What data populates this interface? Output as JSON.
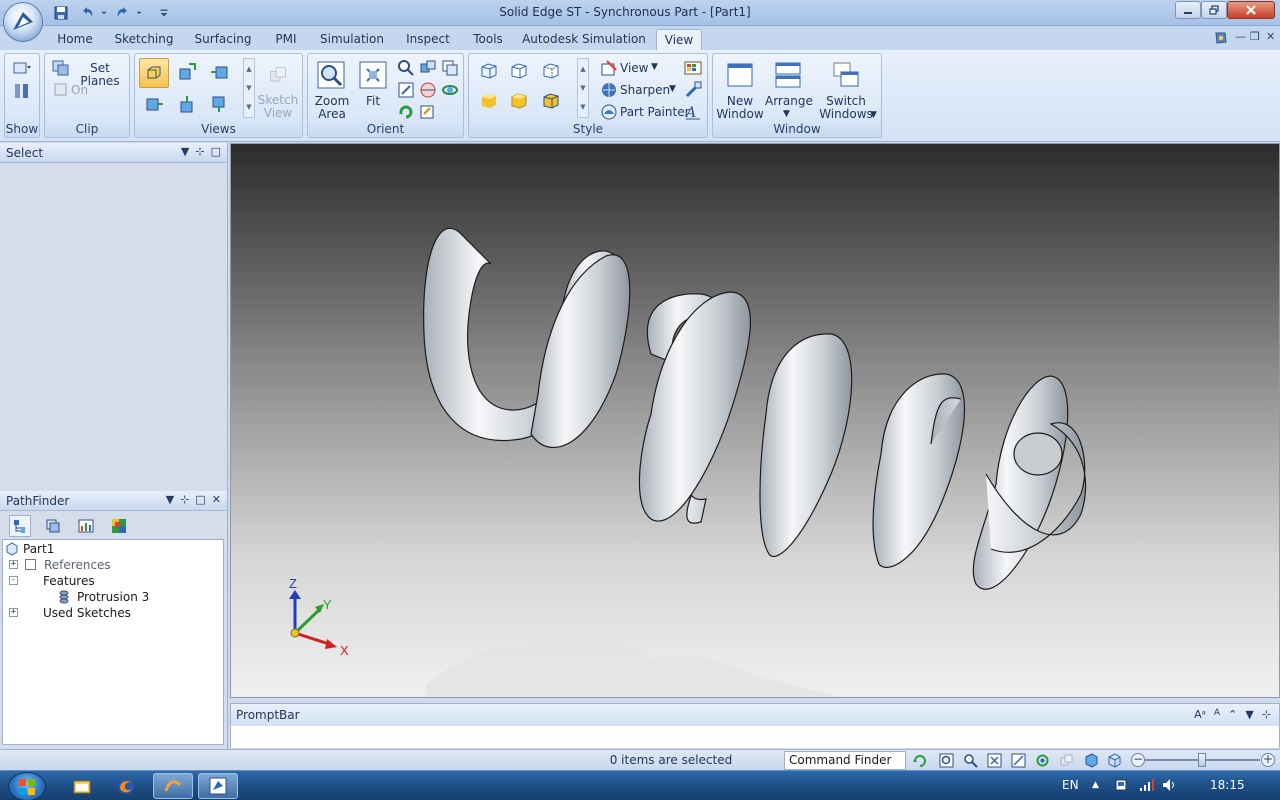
{
  "window": {
    "title": "Solid Edge ST - Synchronous Part - [Part1]",
    "controls": [
      "minimize-icon",
      "restore-icon",
      "close-icon"
    ]
  },
  "quick_access": [
    "save-icon",
    "undo-icon",
    "redo-icon",
    "customize-icon"
  ],
  "tabs": [
    {
      "label": "Home"
    },
    {
      "label": "Sketching"
    },
    {
      "label": "Surfacing"
    },
    {
      "label": "PMI"
    },
    {
      "label": "Simulation"
    },
    {
      "label": "Inspect"
    },
    {
      "label": "Tools"
    },
    {
      "label": "Autodesk Simulation"
    },
    {
      "label": "View",
      "active": true
    }
  ],
  "ribbon": {
    "groups": {
      "show": "Show",
      "clip": "Clip",
      "views": "Views",
      "orient": "Orient",
      "style": "Style",
      "window": "Window"
    },
    "clip": {
      "set_planes": "Set Planes",
      "on": "On"
    },
    "views": {
      "sketch_view": "Sketch\nView"
    },
    "orient": {
      "zoom_area": "Zoom\nArea",
      "fit": "Fit"
    },
    "style": {
      "view": "View",
      "sharpen": "Sharpen",
      "part_painter": "Part Painter"
    },
    "window": {
      "new_window": "New\nWindow",
      "arrange": "Arrange",
      "switch_windows": "Switch\nWindows"
    }
  },
  "select_panel": {
    "title": "Select"
  },
  "pathfinder": {
    "title": "PathFinder",
    "tree": [
      {
        "label": "Part1",
        "level": 0,
        "icon": "part-icon"
      },
      {
        "label": "References",
        "level": 1,
        "expander": "+",
        "checkbox": true
      },
      {
        "label": "Features",
        "level": 1,
        "expander": "-"
      },
      {
        "label": "Protrusion 3",
        "level": 2,
        "icon": "protrusion-icon"
      },
      {
        "label": "Used Sketches",
        "level": 1,
        "expander": "+"
      }
    ]
  },
  "viewport": {
    "model": "helical-spring",
    "triad": {
      "z": "Z",
      "y": "Y",
      "x": "X"
    }
  },
  "promptbar": {
    "title": "PromptBar"
  },
  "status": {
    "selection": "0 items are selected",
    "command_finder": "Command Finder"
  },
  "taskbar": {
    "language": "EN",
    "clock": "18:15"
  }
}
